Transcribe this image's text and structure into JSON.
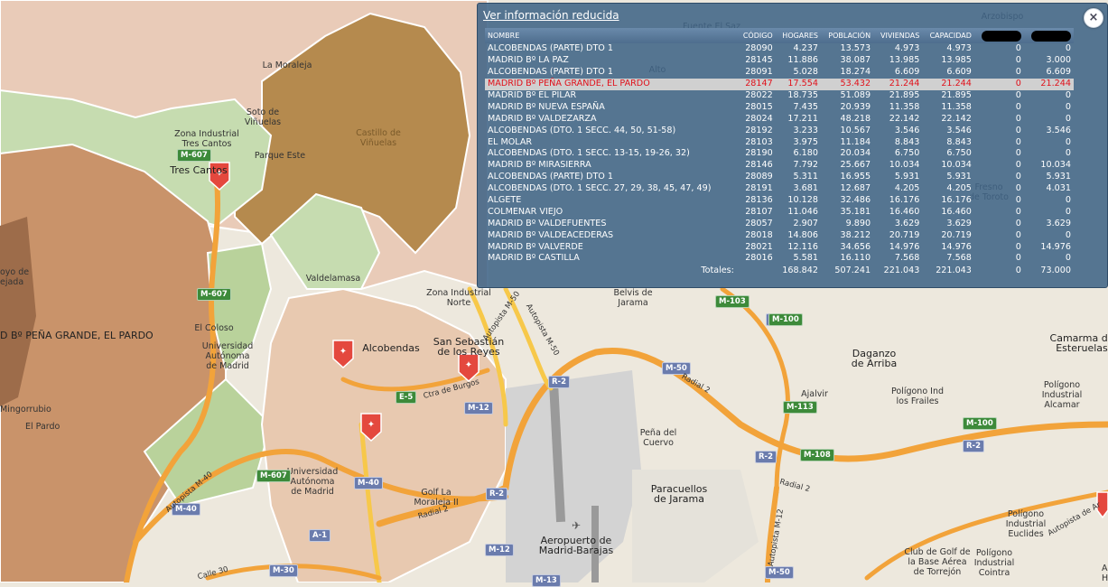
{
  "map": {
    "places": [
      {
        "id": "lamoraleja",
        "text": "La Moraleja"
      },
      {
        "id": "sotovinuelas",
        "text": "Soto de\nViñuelas"
      },
      {
        "id": "castillo",
        "text": "Castillo de\nViñuelas"
      },
      {
        "id": "zonatrescantos",
        "text": "Zona Industrial\nTres Cantos"
      },
      {
        "id": "parqueeste",
        "text": "Parque Este"
      },
      {
        "id": "trescantos",
        "text": "Tres Cantos"
      },
      {
        "id": "valdelamasa",
        "text": "Valdelamasa"
      },
      {
        "id": "zonanorte",
        "text": "Zona Industrial\nNorte"
      },
      {
        "id": "belvis",
        "text": "Belvis de\nJarama"
      },
      {
        "id": "elcoloso",
        "text": "El Coloso"
      },
      {
        "id": "uam1",
        "text": "Universidad\nAutónoma\nde Madrid"
      },
      {
        "id": "pardo",
        "text": "D Bº PEÑA GRANDE, EL PARDO"
      },
      {
        "id": "alcobendas",
        "text": "Alcobendas"
      },
      {
        "id": "sanse",
        "text": "San Sebastián\nde los Reyes"
      },
      {
        "id": "hoyo",
        "text": "oyo de\nejada"
      },
      {
        "id": "mingorrubio",
        "text": "Mingorrubio"
      },
      {
        "id": "elpardo",
        "text": "El Pardo"
      },
      {
        "id": "uam2",
        "text": "Universidad\nAutónoma\nde Madrid"
      },
      {
        "id": "golf",
        "text": "Golf La\nMoraleja II"
      },
      {
        "id": "penacuervo",
        "text": "Peña del\nCuervo"
      },
      {
        "id": "paracuellos",
        "text": "Paracuellos\nde Jarama"
      },
      {
        "id": "aeropuerto",
        "text": "Aeropuerto de\nMadrid-Barajas"
      },
      {
        "id": "daganzo",
        "text": "Daganzo\nde Arriba"
      },
      {
        "id": "ajalvir",
        "text": "Ajalvir"
      },
      {
        "id": "frailes",
        "text": "Polígono Ind\nlos Frailes"
      },
      {
        "id": "camarma",
        "text": "Camarma de\nEsteruelas"
      },
      {
        "id": "alcamar",
        "text": "Polígono\nIndustrial\nAlcamar"
      },
      {
        "id": "euclides",
        "text": "Polígono\nIndustrial\nEuclides"
      },
      {
        "id": "cointra",
        "text": "Polígono\nIndustrial\nCointra"
      },
      {
        "id": "clubgolf",
        "text": "Club de Golf de\nla Base Aérea\nde Torrejón"
      },
      {
        "id": "fresno",
        "text": "Fresno\nde Toroto"
      },
      {
        "id": "fuente",
        "text": "Fuente El Saz"
      },
      {
        "id": "arzobispo",
        "text": "Arzobispo"
      },
      {
        "id": "altoalco",
        "text": "Alto"
      },
      {
        "id": "ah",
        "text": "Al\nH"
      }
    ],
    "roads": [
      {
        "id": "m607a",
        "text": "M-607",
        "style": "green"
      },
      {
        "id": "m607b",
        "text": "M-607",
        "style": "green"
      },
      {
        "id": "m607c",
        "text": "M-607",
        "style": "green"
      },
      {
        "id": "e5",
        "text": "E-5",
        "style": "green"
      },
      {
        "id": "m12a",
        "text": "M-12",
        "style": "blue"
      },
      {
        "id": "m12b",
        "text": "M-12",
        "style": "blue"
      },
      {
        "id": "m40a",
        "text": "M-40",
        "style": "blue"
      },
      {
        "id": "m40b",
        "text": "M-40",
        "style": "blue"
      },
      {
        "id": "m50a",
        "text": "M-50",
        "style": "blue"
      },
      {
        "id": "m50b",
        "text": "M-50",
        "style": "blue"
      },
      {
        "id": "m50c",
        "text": "M-50",
        "style": "blue"
      },
      {
        "id": "m13",
        "text": "M-13",
        "style": "blue"
      },
      {
        "id": "r2a",
        "text": "R-2",
        "style": "blue"
      },
      {
        "id": "r2b",
        "text": "R-2",
        "style": "blue"
      },
      {
        "id": "r2c",
        "text": "R-2",
        "style": "blue"
      },
      {
        "id": "r2d",
        "text": "R-2",
        "style": "blue"
      },
      {
        "id": "a1",
        "text": "A-1",
        "style": "blue"
      },
      {
        "id": "m113",
        "text": "M-113",
        "style": "green"
      },
      {
        "id": "m108",
        "text": "M-108",
        "style": "green"
      },
      {
        "id": "m100a",
        "text": "M-100",
        "style": "green"
      },
      {
        "id": "m100b",
        "text": "M-100",
        "style": "green"
      },
      {
        "id": "m103",
        "text": "M-103",
        "style": "green"
      },
      {
        "id": "m30",
        "text": "M-30",
        "style": "blue"
      }
    ],
    "road_names": [
      {
        "id": "rn1",
        "text": "Autopista M-40"
      },
      {
        "id": "rn2",
        "text": "Ctra de Burgos"
      },
      {
        "id": "rn3",
        "text": "Radial 2"
      },
      {
        "id": "rn4",
        "text": "Radial 2"
      },
      {
        "id": "rn5",
        "text": "Radial 2"
      },
      {
        "id": "rn6",
        "text": "Autopista M-50"
      },
      {
        "id": "rn7",
        "text": "Autopista M-50"
      },
      {
        "id": "rn8",
        "text": "Autopista de Ar"
      },
      {
        "id": "rn9",
        "text": "Calle 30"
      },
      {
        "id": "rn10",
        "text": "Autopista M-12"
      }
    ],
    "store_icon": "carrefour-marker-icon",
    "colors": {
      "pardo": "#c9936a",
      "brown": "#b0804a",
      "green": "#c6dcb0",
      "base": "#ede8dd",
      "road": "#f0a030"
    }
  },
  "panel": {
    "link_label": "Ver información reducida",
    "close_label": "×",
    "columns": [
      "NOMBRE",
      "CÓDIGO",
      "HOGARES",
      "POBLACIÓN",
      "VIVIENDAS",
      "CAPACIDAD",
      "",
      ""
    ],
    "rows": [
      [
        "ALCOBENDAS (PARTE) DTO 1",
        "28090",
        "4.237",
        "13.573",
        "4.973",
        "4.973",
        "0",
        "0"
      ],
      [
        "MADRID Bº LA PAZ",
        "28145",
        "11.886",
        "38.087",
        "13.985",
        "13.985",
        "0",
        "3.000"
      ],
      [
        "ALCOBENDAS (PARTE) DTO 1",
        "28091",
        "5.028",
        "18.274",
        "6.609",
        "6.609",
        "0",
        "6.609"
      ],
      [
        "MADRID Bº PEÑA GRANDE, EL PARDO",
        "28147",
        "17.554",
        "53.432",
        "21.244",
        "21.244",
        "0",
        "21.244"
      ],
      [
        "MADRID Bº EL PILAR",
        "28022",
        "18.735",
        "51.089",
        "21.895",
        "21.895",
        "0",
        "0"
      ],
      [
        "MADRID Bº NUEVA ESPAÑA",
        "28015",
        "7.435",
        "20.939",
        "11.358",
        "11.358",
        "0",
        "0"
      ],
      [
        "MADRID Bº VALDEZARZA",
        "28024",
        "17.211",
        "48.218",
        "22.142",
        "22.142",
        "0",
        "0"
      ],
      [
        "ALCOBENDAS (DTO. 1 SECC. 44, 50, 51-58)",
        "28192",
        "3.233",
        "10.567",
        "3.546",
        "3.546",
        "0",
        "3.546"
      ],
      [
        "EL MOLAR",
        "28103",
        "3.975",
        "11.184",
        "8.843",
        "8.843",
        "0",
        "0"
      ],
      [
        "ALCOBENDAS (DTO. 1 SECC. 13-15, 19-26, 32)",
        "28190",
        "6.180",
        "20.034",
        "6.750",
        "6.750",
        "0",
        "0"
      ],
      [
        "MADRID Bº MIRASIERRA",
        "28146",
        "7.792",
        "25.667",
        "10.034",
        "10.034",
        "0",
        "10.034"
      ],
      [
        "ALCOBENDAS (PARTE) DTO 1",
        "28089",
        "5.311",
        "16.955",
        "5.931",
        "5.931",
        "0",
        "5.931"
      ],
      [
        "ALCOBENDAS (DTO. 1 SECC. 27, 29, 38, 45, 47, 49)",
        "28191",
        "3.681",
        "12.687",
        "4.205",
        "4.205",
        "0",
        "4.031"
      ],
      [
        "ALGETE",
        "28136",
        "10.128",
        "32.486",
        "16.176",
        "16.176",
        "0",
        "0"
      ],
      [
        "COLMENAR VIEJO",
        "28107",
        "11.046",
        "35.181",
        "16.460",
        "16.460",
        "0",
        "0"
      ],
      [
        "MADRID Bº VALDEFUENTES",
        "28057",
        "2.907",
        "9.890",
        "3.629",
        "3.629",
        "0",
        "3.629"
      ],
      [
        "MADRID Bº VALDEACEDERAS",
        "28018",
        "14.806",
        "38.212",
        "20.719",
        "20.719",
        "0",
        "0"
      ],
      [
        "MADRID Bº VALVERDE",
        "28021",
        "12.116",
        "34.656",
        "14.976",
        "14.976",
        "0",
        "14.976"
      ],
      [
        "MADRID Bº CASTILLA",
        "28016",
        "5.581",
        "16.110",
        "7.568",
        "7.568",
        "0",
        "0"
      ]
    ],
    "highlight_row": 3,
    "totals": [
      "Totales:",
      "",
      "168.842",
      "507.241",
      "221.043",
      "221.043",
      "0",
      "73.000"
    ]
  }
}
